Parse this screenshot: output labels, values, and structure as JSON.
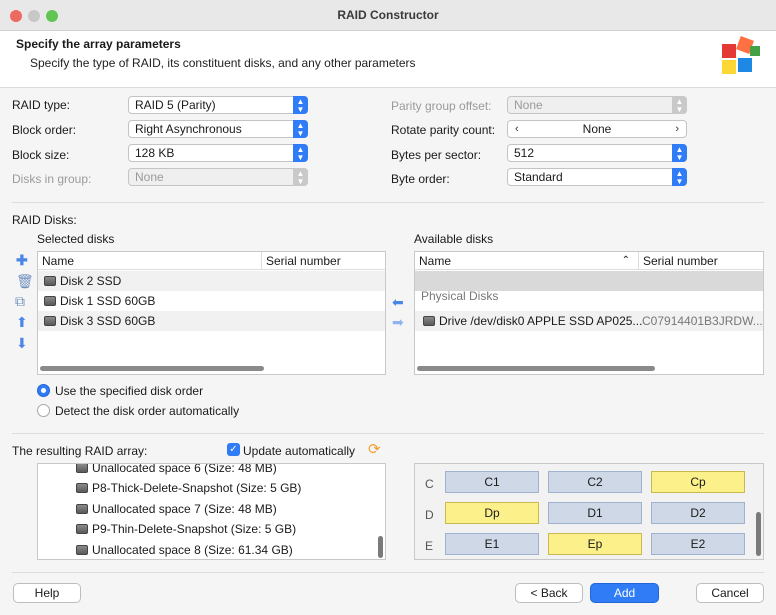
{
  "window": {
    "title": "RAID Constructor"
  },
  "header": {
    "title": "Specify the array parameters",
    "subtitle": "Specify the type of RAID, its constituent disks, and any other parameters"
  },
  "params": {
    "raid_type": {
      "label": "RAID type:",
      "value": "RAID 5 (Parity)"
    },
    "block_order": {
      "label": "Block order:",
      "value": "Right Asynchronous"
    },
    "block_size": {
      "label": "Block size:",
      "value": "128 KB"
    },
    "disks_in_group": {
      "label": "Disks in group:",
      "value": "None"
    },
    "parity_group_offset": {
      "label": "Parity group offset:",
      "value": "None"
    },
    "rotate_parity_count": {
      "label": "Rotate parity count:",
      "value": "None"
    },
    "bytes_per_sector": {
      "label": "Bytes per sector:",
      "value": "512"
    },
    "byte_order": {
      "label": "Byte order:",
      "value": "Standard"
    }
  },
  "raid_disks": {
    "label": "RAID Disks:",
    "selected": {
      "label": "Selected disks",
      "columns": [
        "Name",
        "Serial number"
      ],
      "rows": [
        {
          "name": "Disk 2 SSD",
          "serial": ""
        },
        {
          "name": "Disk 1 SSD 60GB",
          "serial": ""
        },
        {
          "name": "Disk 3 SSD 60GB",
          "serial": ""
        }
      ]
    },
    "available": {
      "label": "Available disks",
      "columns": [
        "Name",
        "Serial number"
      ],
      "group": "Physical Disks",
      "rows": [
        {
          "name": "Drive /dev/disk0 APPLE SSD AP025...",
          "serial": "C07914401B3JRDW..."
        }
      ]
    },
    "order_options": [
      "Use the specified disk order",
      "Detect the disk order automatically"
    ],
    "order_selected": 0
  },
  "result": {
    "label": "The resulting RAID array:",
    "update_label": "Update automatically",
    "update_checked": true,
    "items": [
      "Unallocated space 6 (Size: 48 MB)",
      "P8-Thick-Delete-Snapshot (Size: 5 GB)",
      "Unallocated space 7 (Size: 48 MB)",
      "P9-Thin-Delete-Snapshot (Size: 5 GB)",
      "Unallocated space 8 (Size: 61.34 GB)"
    ]
  },
  "layout_grid": {
    "rows": [
      {
        "label": "C",
        "cells": [
          {
            "text": "C1",
            "parity": false
          },
          {
            "text": "C2",
            "parity": false
          },
          {
            "text": "Cp",
            "parity": true
          }
        ]
      },
      {
        "label": "D",
        "cells": [
          {
            "text": "Dp",
            "parity": true
          },
          {
            "text": "D1",
            "parity": false
          },
          {
            "text": "D2",
            "parity": false
          }
        ]
      },
      {
        "label": "E",
        "cells": [
          {
            "text": "E1",
            "parity": false
          },
          {
            "text": "Ep",
            "parity": true
          },
          {
            "text": "E2",
            "parity": false
          }
        ]
      }
    ]
  },
  "footer": {
    "help": "Help",
    "back": "< Back",
    "add": "Add",
    "cancel": "Cancel"
  },
  "colors": {
    "accent": "#2f7cf6",
    "parity": "#fbf08a",
    "data_cell": "#cfd8e6"
  }
}
